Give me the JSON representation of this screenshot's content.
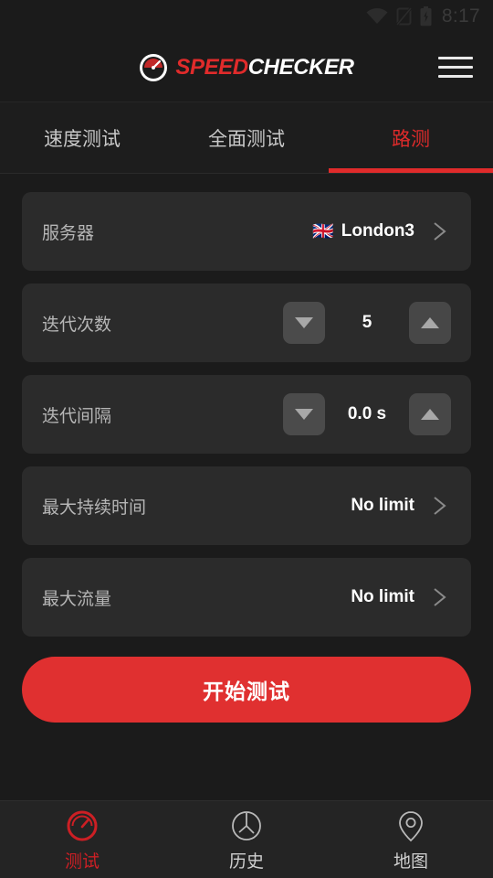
{
  "status_bar": {
    "time": "8:17",
    "icons": [
      "wifi-icon",
      "no-sim-icon",
      "battery-charging-icon"
    ]
  },
  "header": {
    "logo_icon": "speedometer-logo-icon",
    "logo_primary": "SPEED",
    "logo_secondary": "CHECKER",
    "menu_icon": "hamburger-menu-icon",
    "accent_color": "#e02b2b"
  },
  "tabs": [
    {
      "label": "速度测试",
      "active": false
    },
    {
      "label": "全面测试",
      "active": false
    },
    {
      "label": "路测",
      "active": true
    }
  ],
  "settings": {
    "server": {
      "label": "服务器",
      "flag": "🇬🇧",
      "value": "London3",
      "chevron_icon": "chevron-right-icon"
    },
    "iterations": {
      "label": "迭代次数",
      "value": "5",
      "decrement_icon": "triangle-down-icon",
      "increment_icon": "triangle-up-icon"
    },
    "interval": {
      "label": "迭代间隔",
      "value": "0.0 s",
      "decrement_icon": "triangle-down-icon",
      "increment_icon": "triangle-up-icon"
    },
    "max_duration": {
      "label": "最大持续时间",
      "value": "No limit",
      "chevron_icon": "chevron-right-icon"
    },
    "max_traffic": {
      "label": "最大流量",
      "value": "No limit",
      "chevron_icon": "chevron-right-icon"
    }
  },
  "start_button": {
    "label": "开始测试",
    "color": "#e03030"
  },
  "bottom_nav": [
    {
      "label": "测试",
      "icon": "speedometer-icon",
      "active": true
    },
    {
      "label": "历史",
      "icon": "clock-icon",
      "active": false
    },
    {
      "label": "地图",
      "icon": "map-pin-icon",
      "active": false
    }
  ]
}
